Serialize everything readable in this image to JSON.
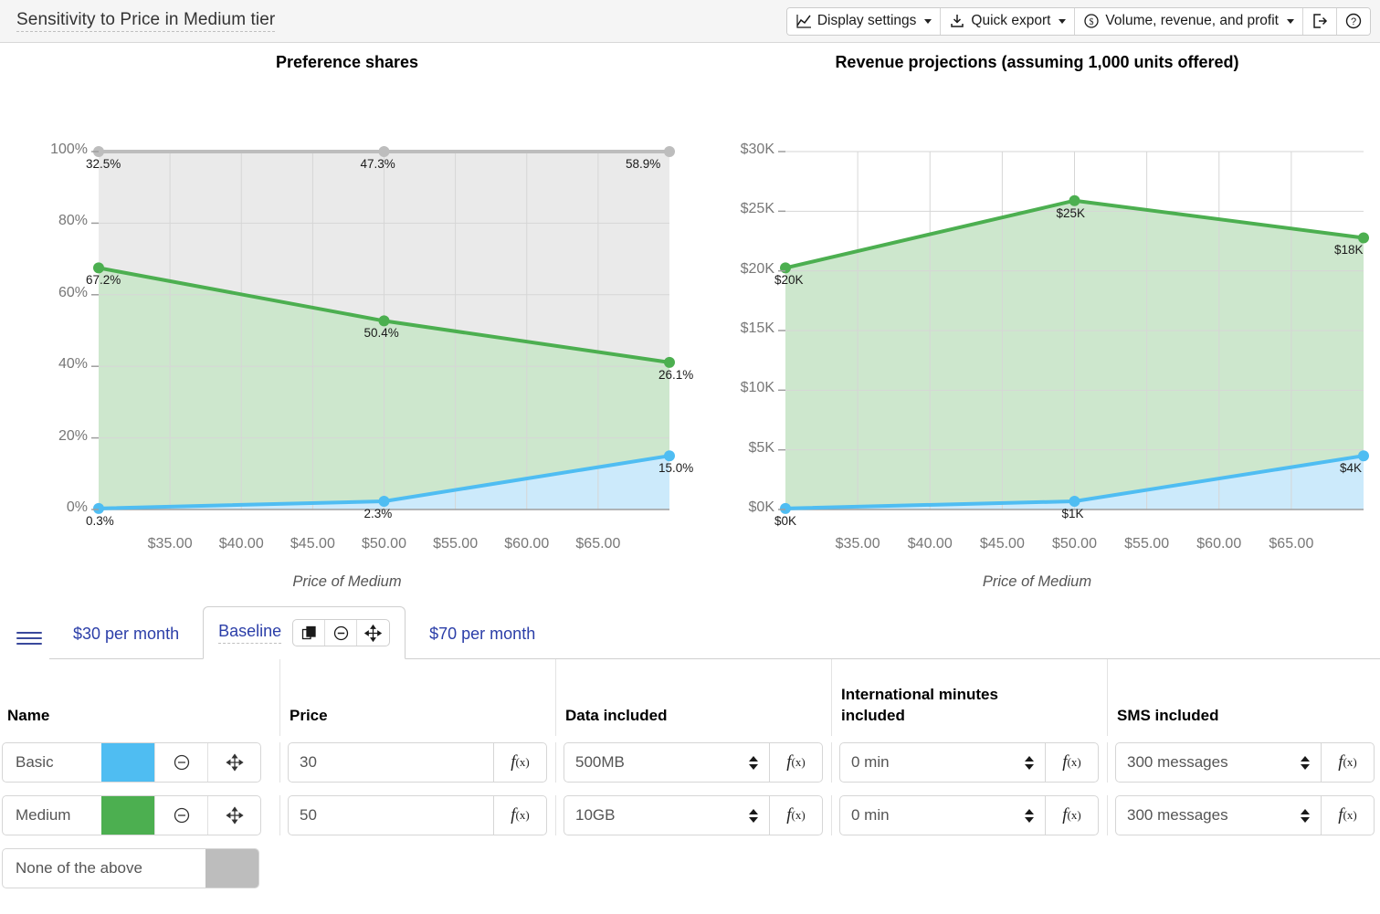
{
  "header": {
    "title": "Sensitivity to Price in Medium tier",
    "toolbar": [
      {
        "id": "display-settings",
        "label": "Display settings",
        "icon": "line-chart-icon",
        "caret": true
      },
      {
        "id": "quick-export",
        "label": "Quick export",
        "icon": "download-icon",
        "caret": true
      },
      {
        "id": "metric-selector",
        "label": "Volume, revenue, and profit",
        "icon": "dollar-circle-icon",
        "caret": true
      },
      {
        "id": "export-view",
        "label": "",
        "icon": "exit-arrow-icon",
        "caret": false
      },
      {
        "id": "help",
        "label": "",
        "icon": "question-circle-icon",
        "caret": false
      }
    ]
  },
  "colors": {
    "basic": "#4FBDF2",
    "medium": "#4CAF50",
    "none": "#BDBDBD",
    "basic_fill": "#CCEAFB",
    "medium_fill": "#CDE7CD",
    "none_fill": "#EAEAEA",
    "accent_link": "#2B3EA8"
  },
  "chart_data": [
    {
      "type": "area",
      "id": "preference-shares",
      "title": "Preference shares",
      "xlabel": "Price of Medium",
      "ylabel": "",
      "x": [
        30,
        50,
        70
      ],
      "xtick_labels": [
        "$35.00",
        "$40.00",
        "$45.00",
        "$50.00",
        "$55.00",
        "$60.00",
        "$65.00"
      ],
      "xtick_values": [
        35,
        40,
        45,
        50,
        55,
        60,
        65
      ],
      "xlim": [
        30,
        70
      ],
      "ytick_labels": [
        "0%",
        "20%",
        "40%",
        "60%",
        "80%",
        "100%"
      ],
      "ytick_values": [
        0,
        20,
        40,
        60,
        80,
        100
      ],
      "ylim": [
        0,
        100
      ],
      "grid": true,
      "stacked": true,
      "series": [
        {
          "name": "Basic",
          "color": "#4FBDF2",
          "values": [
            0.3,
            2.3,
            15.0
          ],
          "labels": [
            "0.3%",
            "2.3%",
            "15.0%"
          ]
        },
        {
          "name": "Medium",
          "color": "#4CAF50",
          "values": [
            67.2,
            50.4,
            26.1
          ],
          "labels": [
            "67.2%",
            "50.4%",
            "26.1%"
          ]
        },
        {
          "name": "None of the above",
          "color": "#BDBDBD",
          "values": [
            32.5,
            47.3,
            58.9
          ],
          "labels": [
            "32.5%",
            "47.3%",
            "58.9%"
          ]
        }
      ]
    },
    {
      "type": "area",
      "id": "revenue-projections",
      "title": "Revenue projections (assuming 1,000 units offered)",
      "xlabel": "Price of Medium",
      "ylabel": "",
      "x": [
        30,
        50,
        70
      ],
      "xtick_labels": [
        "$35.00",
        "$40.00",
        "$45.00",
        "$50.00",
        "$55.00",
        "$60.00",
        "$65.00"
      ],
      "xtick_values": [
        35,
        40,
        45,
        50,
        55,
        60,
        65
      ],
      "xlim": [
        30,
        70
      ],
      "ytick_labels": [
        "$0K",
        "$5K",
        "$10K",
        "$15K",
        "$20K",
        "$25K",
        "$30K"
      ],
      "ytick_values": [
        0,
        5,
        10,
        15,
        20,
        25,
        30
      ],
      "ylim": [
        0,
        30
      ],
      "grid": true,
      "stacked": true,
      "series": [
        {
          "name": "Basic",
          "color": "#4FBDF2",
          "values": [
            0.09,
            0.69,
            4.5
          ],
          "labels": [
            "$0K",
            "$1K",
            "$4K"
          ]
        },
        {
          "name": "Medium",
          "color": "#4CAF50",
          "values": [
            20.16,
            25.2,
            18.27
          ],
          "labels": [
            "$20K",
            "$25K",
            "$18K"
          ]
        }
      ]
    }
  ],
  "tabs": {
    "menu_icon": "hamburger-icon",
    "items": [
      {
        "label": "$30 per month",
        "active": false
      },
      {
        "label": "Baseline",
        "active": true
      },
      {
        "label": "$70 per month",
        "active": false
      }
    ],
    "active_actions": [
      {
        "id": "duplicate",
        "icon": "duplicate-icon"
      },
      {
        "id": "remove",
        "icon": "minus-circle-icon"
      },
      {
        "id": "move",
        "icon": "move-icon"
      }
    ]
  },
  "table": {
    "columns": [
      "Name",
      "Price",
      "Data included",
      "International minutes included",
      "SMS included"
    ],
    "rows": [
      {
        "name": "Basic",
        "color": "#4FBDF2",
        "price": "30",
        "data_included": "500MB",
        "intl_minutes": "0 min",
        "sms": "300 messages",
        "fx_label": "f(x)"
      },
      {
        "name": "Medium",
        "color": "#4CAF50",
        "price": "50",
        "data_included": "10GB",
        "intl_minutes": "0 min",
        "sms": "300 messages",
        "fx_label": "f(x)"
      }
    ],
    "none_row": {
      "name": "None of the above",
      "color": "#BDBDBD"
    }
  }
}
